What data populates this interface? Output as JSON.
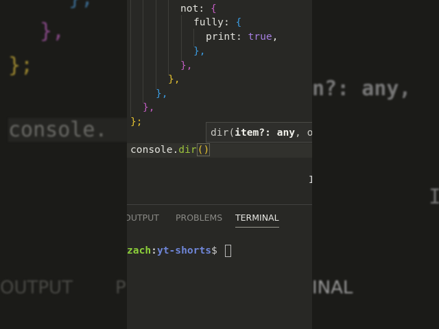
{
  "editor": {
    "lines": [
      {
        "key": "not",
        "brace": "{"
      },
      {
        "key": "fully",
        "brace": "{"
      },
      {
        "key": "print",
        "value": "true"
      }
    ],
    "closers": [
      "},",
      "},",
      "},",
      "},",
      "},",
      "};"
    ],
    "current_line": {
      "object": "console.",
      "method": "dir",
      "parens": "()"
    },
    "signature_hint": {
      "fn": "dir(",
      "param": "item?: any",
      "rest": ", o"
    }
  },
  "panel": {
    "tabs": [
      {
        "label": "OUTPUT"
      },
      {
        "label": "PROBLEMS"
      },
      {
        "label": "TERMINAL",
        "active": true
      }
    ]
  },
  "terminal": {
    "user": "zach",
    "sep": ":",
    "dir": "yt-shorts",
    "symbol": "$"
  },
  "background": {
    "left": [
      "},",
      "},",
      "};",
      "console.",
      "OUTPUT",
      "P"
    ],
    "right": [
      "n?: any,",
      "I",
      "INAL"
    ]
  }
}
